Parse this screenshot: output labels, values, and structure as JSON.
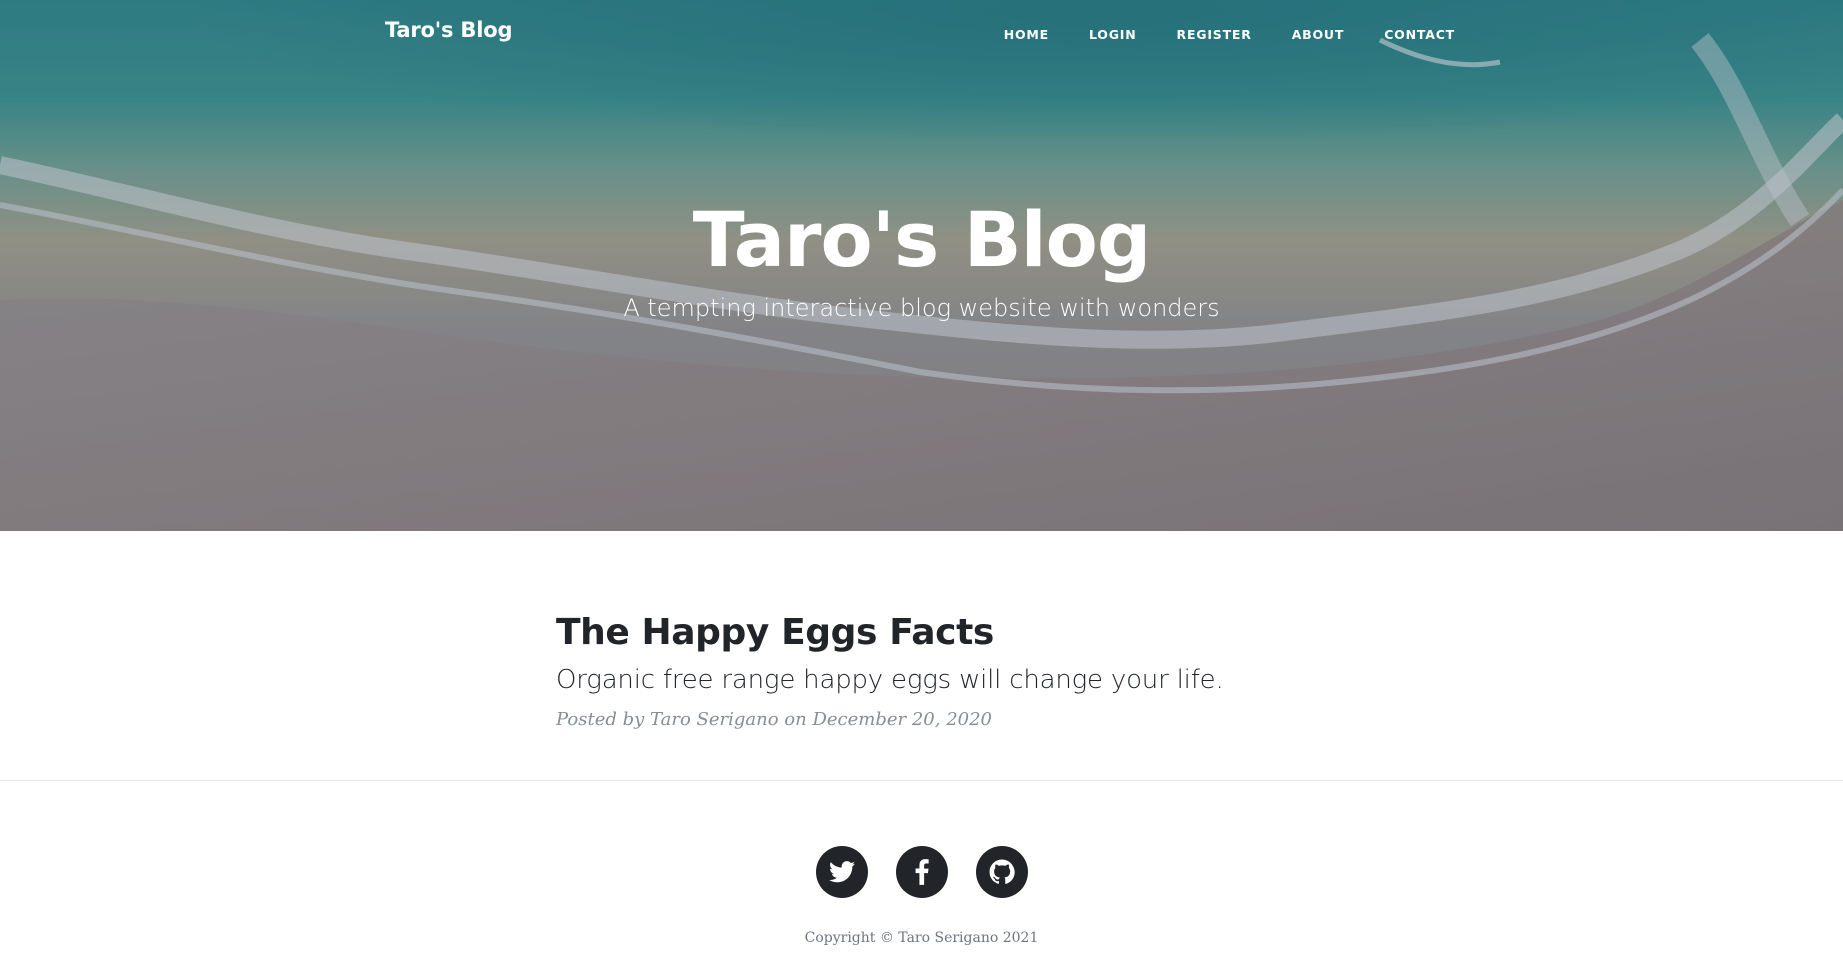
{
  "navbar": {
    "brand": "Taro's Blog",
    "links": [
      "Home",
      "Login",
      "Register",
      "About",
      "Contact"
    ]
  },
  "hero": {
    "title": "Taro's Blog",
    "subtitle": "A tempting interactive blog website with wonders"
  },
  "post": {
    "title": "The Happy Eggs Facts",
    "subtitle": "Organic free range happy eggs will change your life.",
    "meta_prefix": "Posted by",
    "author": "Taro Serigano",
    "meta_on": "on",
    "date": "December 20, 2020"
  },
  "footer": {
    "social": [
      "twitter-icon",
      "facebook-icon",
      "github-icon"
    ],
    "copyright": "Copyright © Taro Serigano 2021"
  },
  "colors": {
    "text_dark": "#212529",
    "meta_gray": "#868e96",
    "white": "#ffffff"
  }
}
